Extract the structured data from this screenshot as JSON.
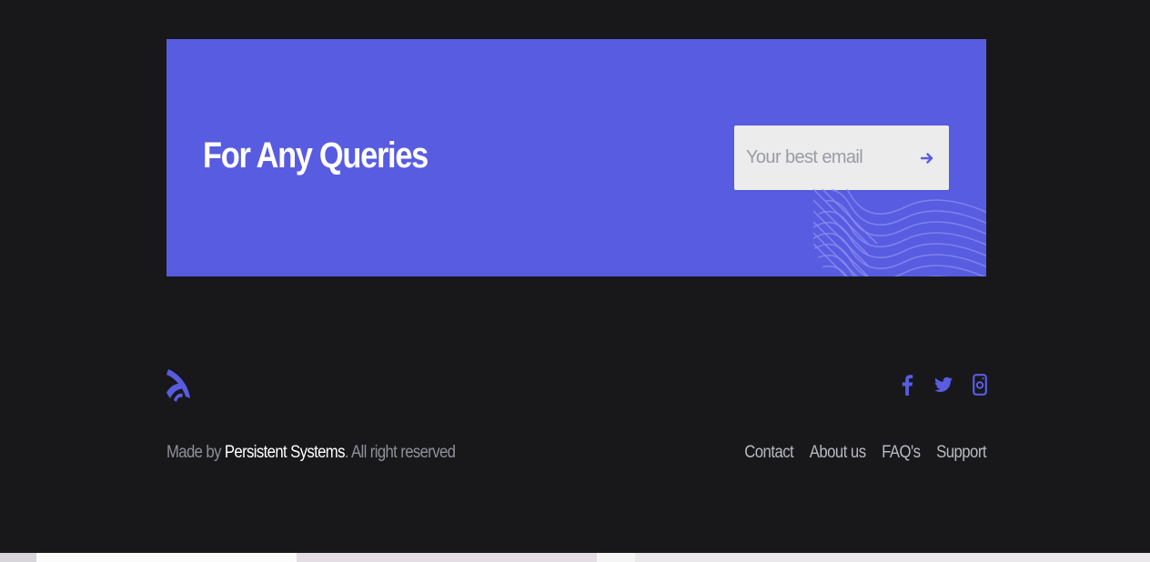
{
  "cta": {
    "title": "For Any Queries",
    "email_placeholder": "Your best email",
    "submit_icon": "arrow-right-icon"
  },
  "footer": {
    "logo_icon": "brand-logo-icon",
    "social": [
      {
        "name": "facebook",
        "icon": "facebook-icon"
      },
      {
        "name": "twitter",
        "icon": "twitter-icon"
      },
      {
        "name": "instagram",
        "icon": "instagram-icon"
      }
    ],
    "copyright_prefix": "Made by ",
    "company": "Persistent Systems",
    "copyright_suffix": ". All right reserved",
    "links": [
      "Contact",
      "About us",
      "FAQ's",
      "Support"
    ]
  },
  "colors": {
    "page_background": "#18181b",
    "accent": "#585ce0",
    "input_background": "#ececed"
  }
}
